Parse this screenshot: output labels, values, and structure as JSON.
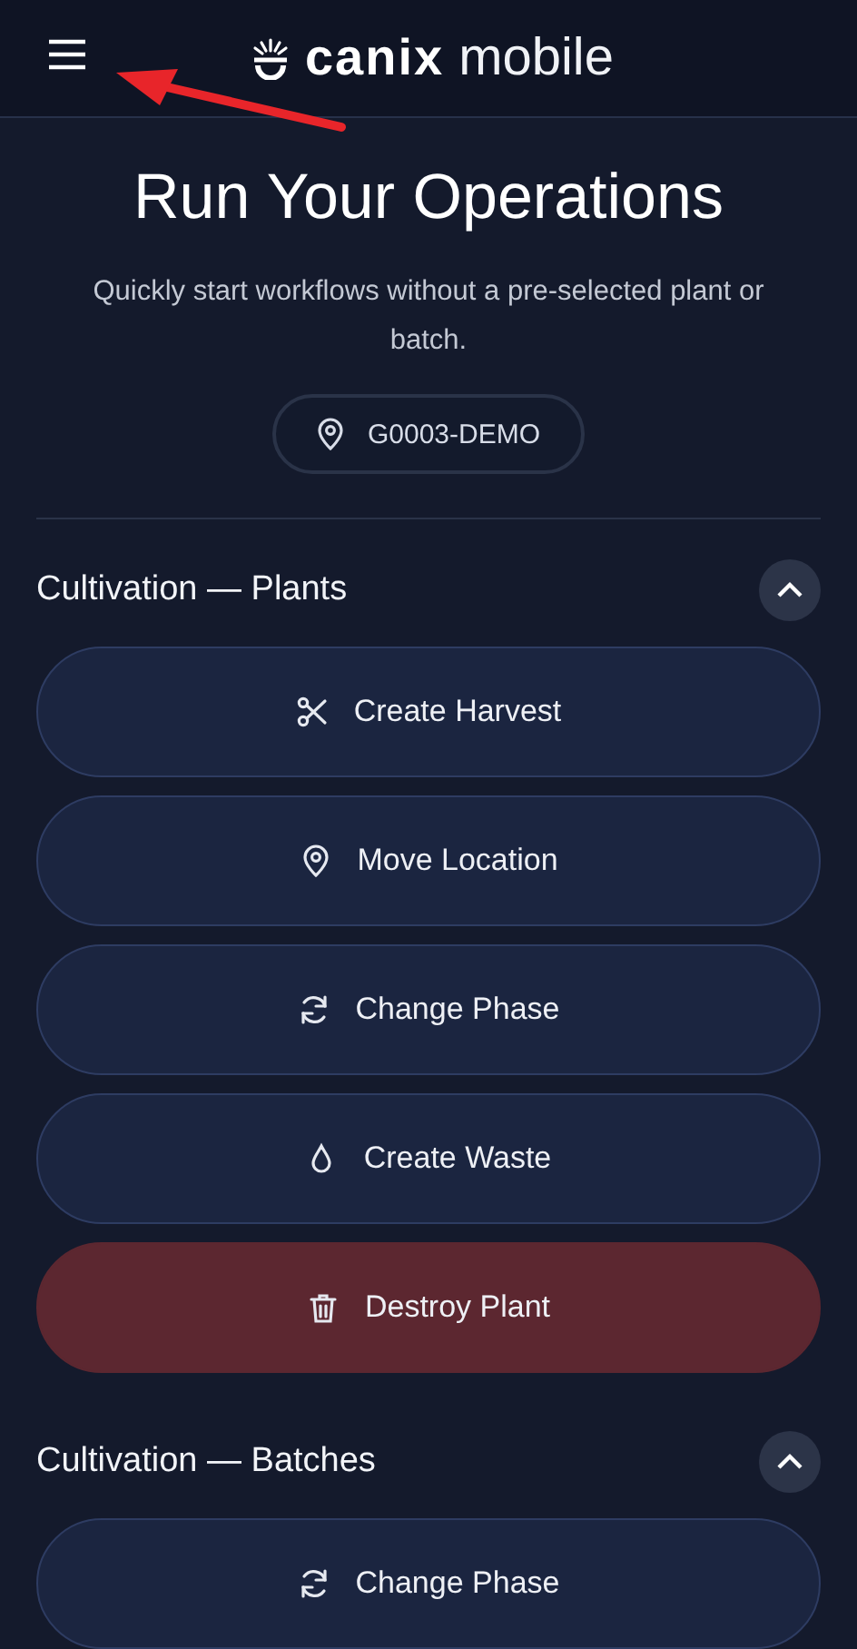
{
  "header": {
    "logo": {
      "brand": "canix",
      "product": "mobile"
    }
  },
  "hero": {
    "title": "Run Your Operations",
    "subtitle": "Quickly start workflows without a pre-selected plant or batch.",
    "location": "G0003-DEMO"
  },
  "sections": [
    {
      "title": "Cultivation — Plants",
      "expanded": true,
      "actions": [
        {
          "label": "Create Harvest",
          "kind": "harvest"
        },
        {
          "label": "Move Location",
          "kind": "move"
        },
        {
          "label": "Change Phase",
          "kind": "phase"
        },
        {
          "label": "Create Waste",
          "kind": "waste"
        },
        {
          "label": "Destroy Plant",
          "kind": "destroy"
        }
      ]
    },
    {
      "title": "Cultivation — Batches",
      "expanded": true,
      "actions": [
        {
          "label": "Change Phase",
          "kind": "phase"
        }
      ]
    }
  ]
}
